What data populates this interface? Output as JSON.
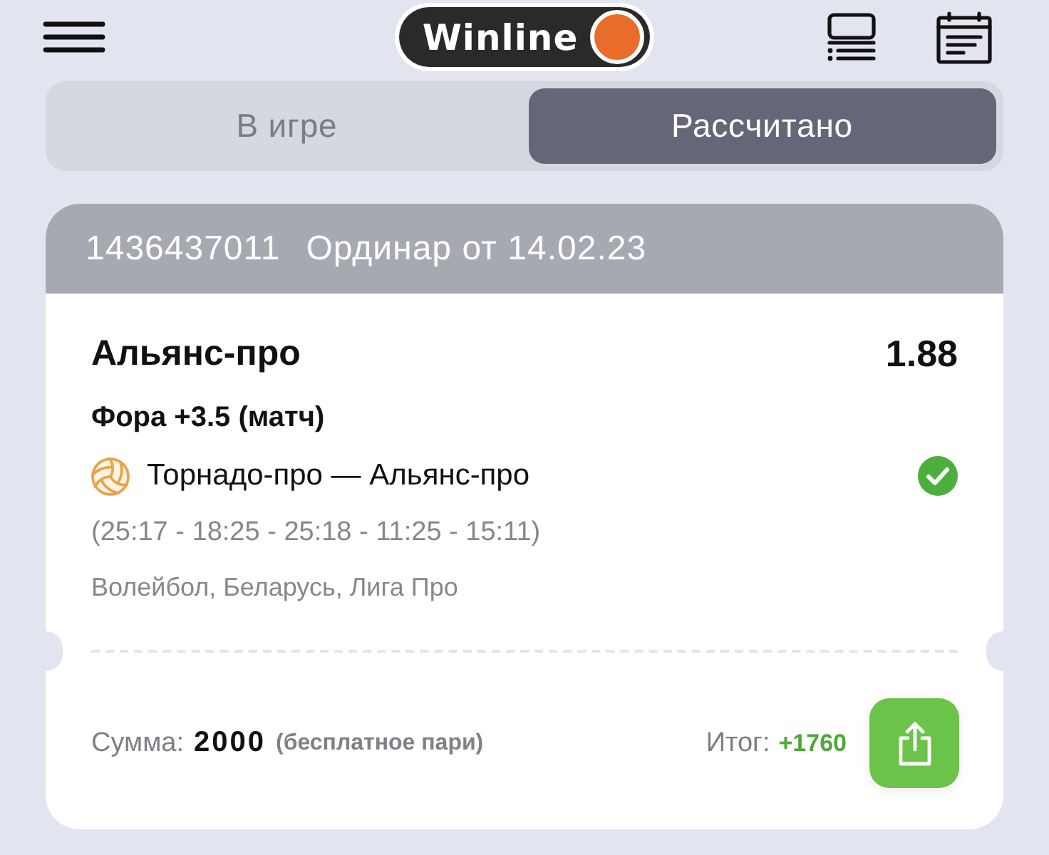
{
  "header": {
    "logo": "Winline"
  },
  "tabs": [
    {
      "label": "В игре",
      "selected": false
    },
    {
      "label": "Рассчитано",
      "selected": true
    }
  ],
  "bet": {
    "number": "1436437011",
    "title": "Ординар от 14.02.23",
    "selection": "Альянс-про",
    "odds": "1.88",
    "market": "Фора +3.5 (матч)",
    "event": "Торнадо-про — Альянс-про",
    "won": true,
    "score": "(25:17 - 18:25 - 25:18 - 11:25 - 15:11)",
    "league": "Волейбол, Беларусь, Лига Про",
    "stake_label": "Сумма:",
    "stake": "2000",
    "stake_note": "(бесплатное пари)",
    "result_label": "Итог:",
    "result": "+1760"
  }
}
